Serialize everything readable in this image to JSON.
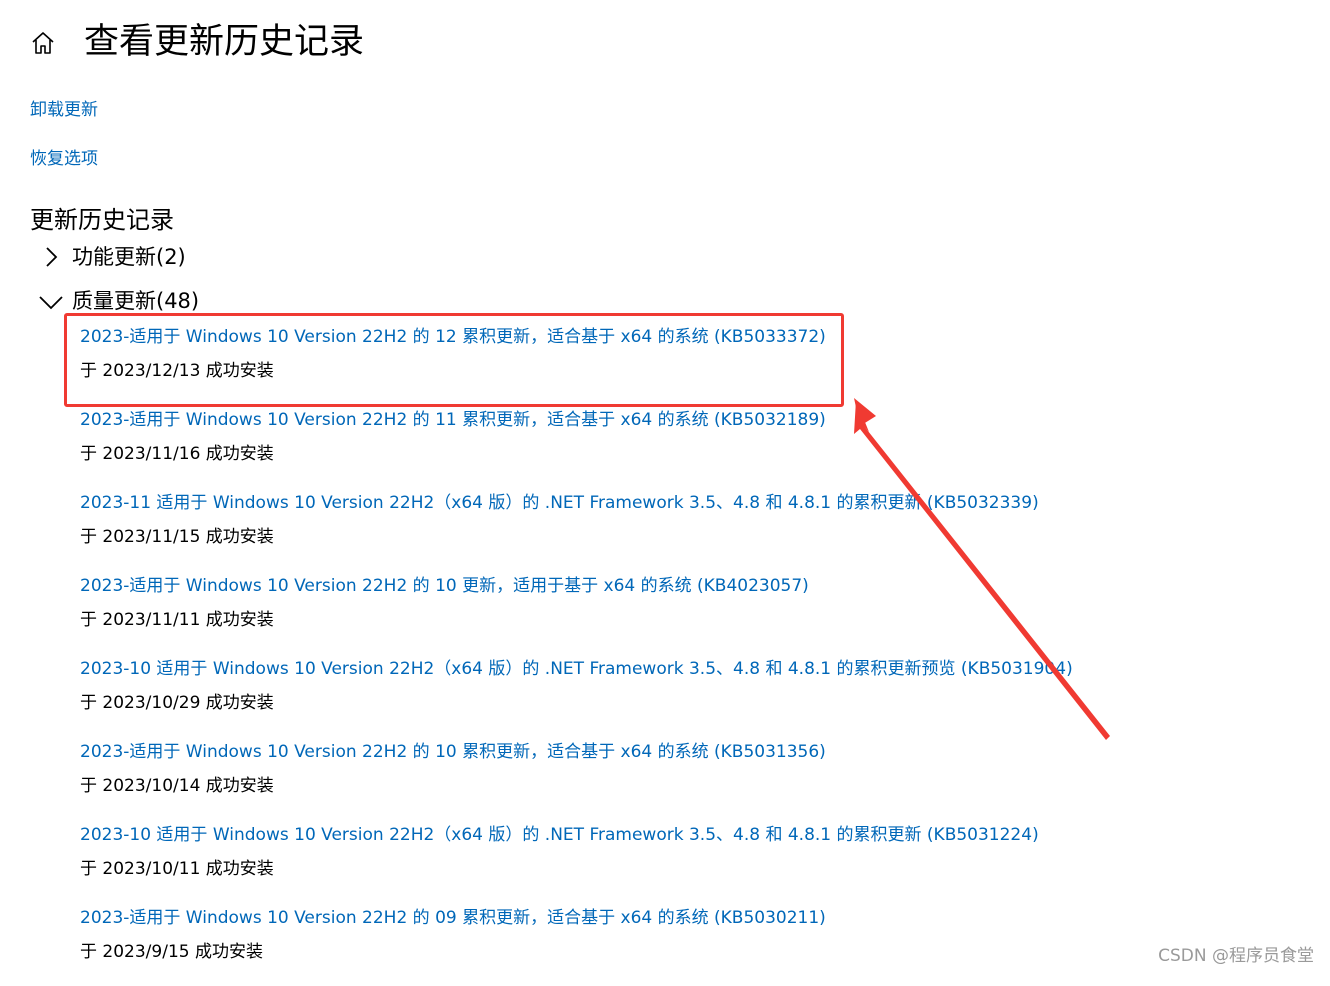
{
  "header": {
    "home_icon": "home-icon",
    "title": "查看更新历史记录"
  },
  "links": {
    "uninstall": "卸载更新",
    "recovery": "恢复选项"
  },
  "history": {
    "title": "更新历史记录",
    "groups": [
      {
        "label": "功能更新(2)",
        "expanded": false
      },
      {
        "label": "质量更新(48)",
        "expanded": true
      }
    ],
    "updates": [
      {
        "title": "2023-适用于 Windows 10 Version 22H2 的 12 累积更新，适合基于 x64 的系统 (KB5033372)",
        "status": "于 2023/12/13 成功安装"
      },
      {
        "title": "2023-适用于 Windows 10 Version 22H2 的 11 累积更新，适合基于 x64 的系统 (KB5032189)",
        "status": "于 2023/11/16 成功安装"
      },
      {
        "title": "2023-11 适用于 Windows 10 Version 22H2（x64 版）的 .NET Framework 3.5、4.8 和 4.8.1 的累积更新 (KB5032339)",
        "status": "于 2023/11/15 成功安装"
      },
      {
        "title": "2023-适用于 Windows 10 Version 22H2 的 10 更新，适用于基于 x64 的系统 (KB4023057)",
        "status": "于 2023/11/11 成功安装"
      },
      {
        "title": "2023-10 适用于 Windows 10 Version 22H2（x64 版）的 .NET Framework 3.5、4.8 和 4.8.1 的累积更新预览 (KB5031904)",
        "status": "于 2023/10/29 成功安装"
      },
      {
        "title": "2023-适用于 Windows 10 Version 22H2 的 10 累积更新，适合基于 x64 的系统 (KB5031356)",
        "status": "于 2023/10/14 成功安装"
      },
      {
        "title": "2023-10 适用于 Windows 10 Version 22H2（x64 版）的 .NET Framework 3.5、4.8 和 4.8.1 的累积更新 (KB5031224)",
        "status": "于 2023/10/11 成功安装"
      },
      {
        "title": "2023-适用于 Windows 10 Version 22H2 的 09 累积更新，适合基于 x64 的系统 (KB5030211)",
        "status": "于 2023/9/15 成功安装"
      }
    ]
  },
  "annotation": {
    "highlight_color": "#f03a32",
    "arrow_color": "#f03a32"
  },
  "colors": {
    "link": "#0067b8"
  },
  "watermark": "CSDN @程序员食堂"
}
